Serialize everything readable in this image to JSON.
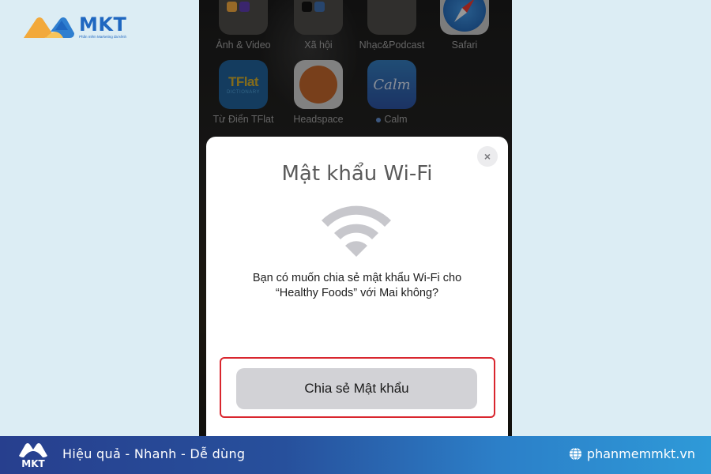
{
  "brand": {
    "name": "MKT",
    "tagline": "Phần mềm Marketing đa kênh",
    "colors": {
      "primary": "#1f67c0",
      "accent": "#f2a93b"
    }
  },
  "home_screen": {
    "apps": [
      {
        "label": "Ảnh & Video",
        "type": "folder",
        "icon": "folder-icon"
      },
      {
        "label": "Xã hội",
        "type": "folder",
        "icon": "folder-icon"
      },
      {
        "label": "Nhạc&Podcast",
        "type": "folder",
        "icon": "folder-icon"
      },
      {
        "label": "Safari",
        "type": "app",
        "icon": "safari-icon"
      },
      {
        "label": "Từ Điển TFlat",
        "type": "app",
        "icon": "tflat-icon",
        "icon_text": "TFlat",
        "icon_subtext": "DICTIONARY"
      },
      {
        "label": "Headspace",
        "type": "app",
        "icon": "headspace-icon"
      },
      {
        "label": "Calm",
        "type": "app",
        "icon": "calm-icon",
        "icon_text": "Calm"
      }
    ]
  },
  "dialog": {
    "title": "Mật khẩu Wi-Fi",
    "close_label": "×",
    "message_line1": "Bạn có muốn chia sẻ mật khẩu Wi-Fi cho",
    "message_line2": "“Healthy Foods” với Mai không?",
    "share_button_label": "Chia sẻ Mật khẩu",
    "highlight_color": "#d9262e"
  },
  "footer": {
    "logo_text": "MKT",
    "slogan": "Hiệu quả - Nhanh  - Dễ dùng",
    "website": "phanmemmkt.vn"
  }
}
